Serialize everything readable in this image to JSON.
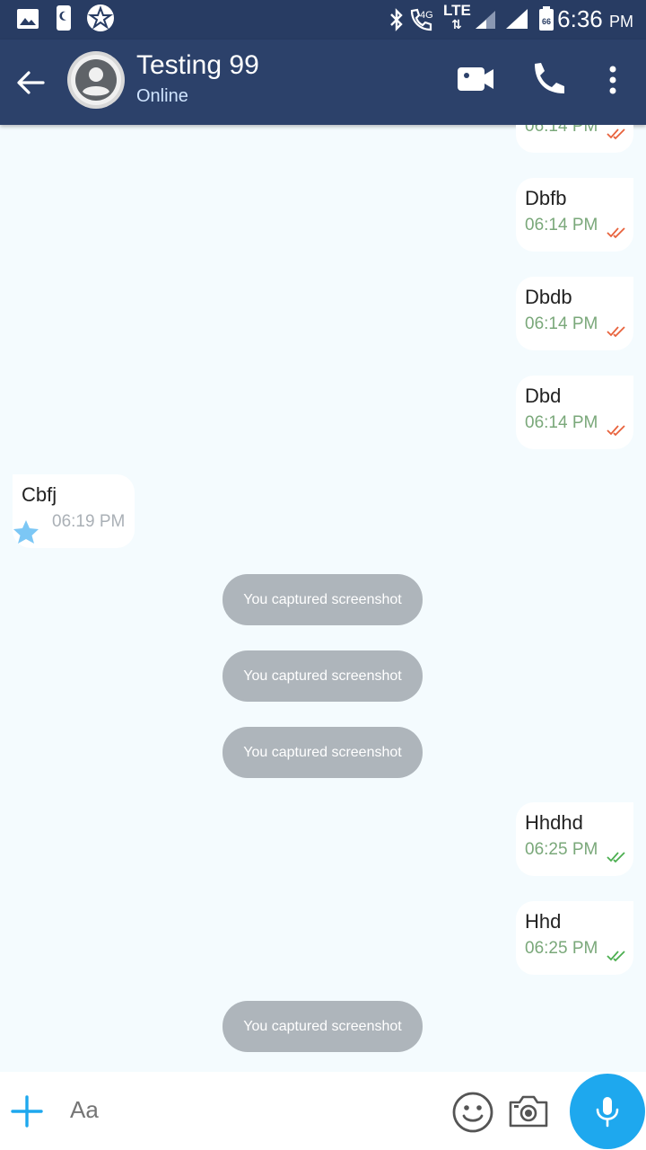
{
  "status_bar": {
    "time": "6:36",
    "ampm": "PM",
    "network_label": "4G",
    "lte_label": "LTE",
    "battery_label": "66"
  },
  "header": {
    "contact_name": "Testing 99",
    "status": "Online"
  },
  "messages": [
    {
      "direction": "out",
      "text": "",
      "time": "06:14 PM",
      "tick_color": "#e8623c"
    },
    {
      "direction": "out",
      "text": "Dbfb",
      "time": "06:14 PM",
      "tick_color": "#e8623c"
    },
    {
      "direction": "out",
      "text": "Dbdb",
      "time": "06:14 PM",
      "tick_color": "#e8623c"
    },
    {
      "direction": "out",
      "text": "Dbd",
      "time": "06:14 PM",
      "tick_color": "#e8623c"
    },
    {
      "direction": "in",
      "text": "Cbfj",
      "time": "06:19 PM"
    },
    {
      "direction": "system",
      "text": "You captured screenshot"
    },
    {
      "direction": "system",
      "text": "You captured screenshot"
    },
    {
      "direction": "system",
      "text": "You captured screenshot"
    },
    {
      "direction": "out",
      "text": "Hhdhd",
      "time": "06:25 PM",
      "tick_color": "#4caf50"
    },
    {
      "direction": "out",
      "text": "Hhd",
      "time": "06:25 PM",
      "tick_color": "#4caf50"
    },
    {
      "direction": "system",
      "text": "You captured screenshot"
    }
  ],
  "composer": {
    "placeholder": "Aa"
  },
  "colors": {
    "header_bg": "#2c416a",
    "statusbar_bg": "#283c63",
    "chat_bg": "#f4fbfe",
    "mic_button": "#1ea8ee",
    "system_bubble": "#aeb5bb",
    "star": "#7cc7f5"
  },
  "icons": {
    "back": "arrow-left-icon",
    "video": "video-camera-icon",
    "call": "phone-icon",
    "more": "more-vertical-icon",
    "plus": "plus-icon",
    "emoji": "smiley-icon",
    "camera": "camera-icon",
    "mic": "microphone-icon",
    "star": "star-icon",
    "tick": "double-check-icon"
  }
}
